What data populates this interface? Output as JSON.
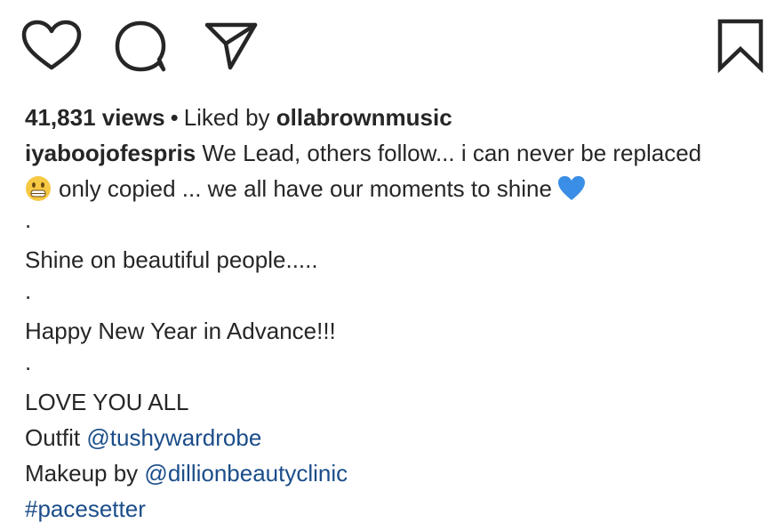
{
  "actions": {
    "like_icon": "heart-outline-icon",
    "comment_icon": "speech-bubble-icon",
    "share_icon": "paper-plane-icon",
    "save_icon": "bookmark-icon"
  },
  "stats": {
    "views": "41,831 views",
    "separator": "•",
    "liked_by_prefix": "Liked by",
    "liked_by_user": "ollabrownmusic"
  },
  "caption": {
    "author": "iyaboojofespris",
    "line1": "We Lead, others follow... i can never be replaced",
    "line2": "only copied ... we all have our moments to shine",
    "dot": ".",
    "line3": "Shine on beautiful people.....",
    "line4": "Happy New Year in Advance!!!",
    "line5": "LOVE YOU ALL",
    "outfit_prefix": "Outfit",
    "outfit_mention": "@tushywardrobe",
    "makeup_prefix": "Makeup by",
    "makeup_mention": "@dillionbeautyclinic",
    "hashtag": "#pacesetter"
  },
  "colors": {
    "text": "#262626",
    "link": "#1b4d8a",
    "heart_emoji": "#3a8ee6",
    "grin_emoji": "#f7c843"
  }
}
